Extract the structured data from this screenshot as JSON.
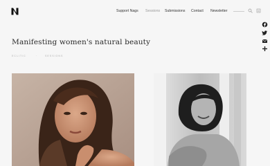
{
  "header": {
    "logo_letter": "N",
    "nav": [
      {
        "label": "Support Nags",
        "active": false
      },
      {
        "label": "Sessions",
        "active": true
      },
      {
        "label": "Submissions",
        "active": false
      },
      {
        "label": "Contact",
        "active": false
      },
      {
        "label": "Newsletter",
        "active": false
      }
    ],
    "icons": [
      "search-icon",
      "menu-icon"
    ]
  },
  "share": [
    "facebook-icon",
    "twitter-icon",
    "email-icon",
    "plus-icon"
  ],
  "page": {
    "title": "Manifesting women's natural beauty",
    "breadcrumb": [
      "Eclitic",
      "Sessions"
    ]
  },
  "colors": {
    "background": "#f6f6f6",
    "text": "#222222",
    "muted": "#b0b0b0",
    "active_nav": "#999999"
  }
}
